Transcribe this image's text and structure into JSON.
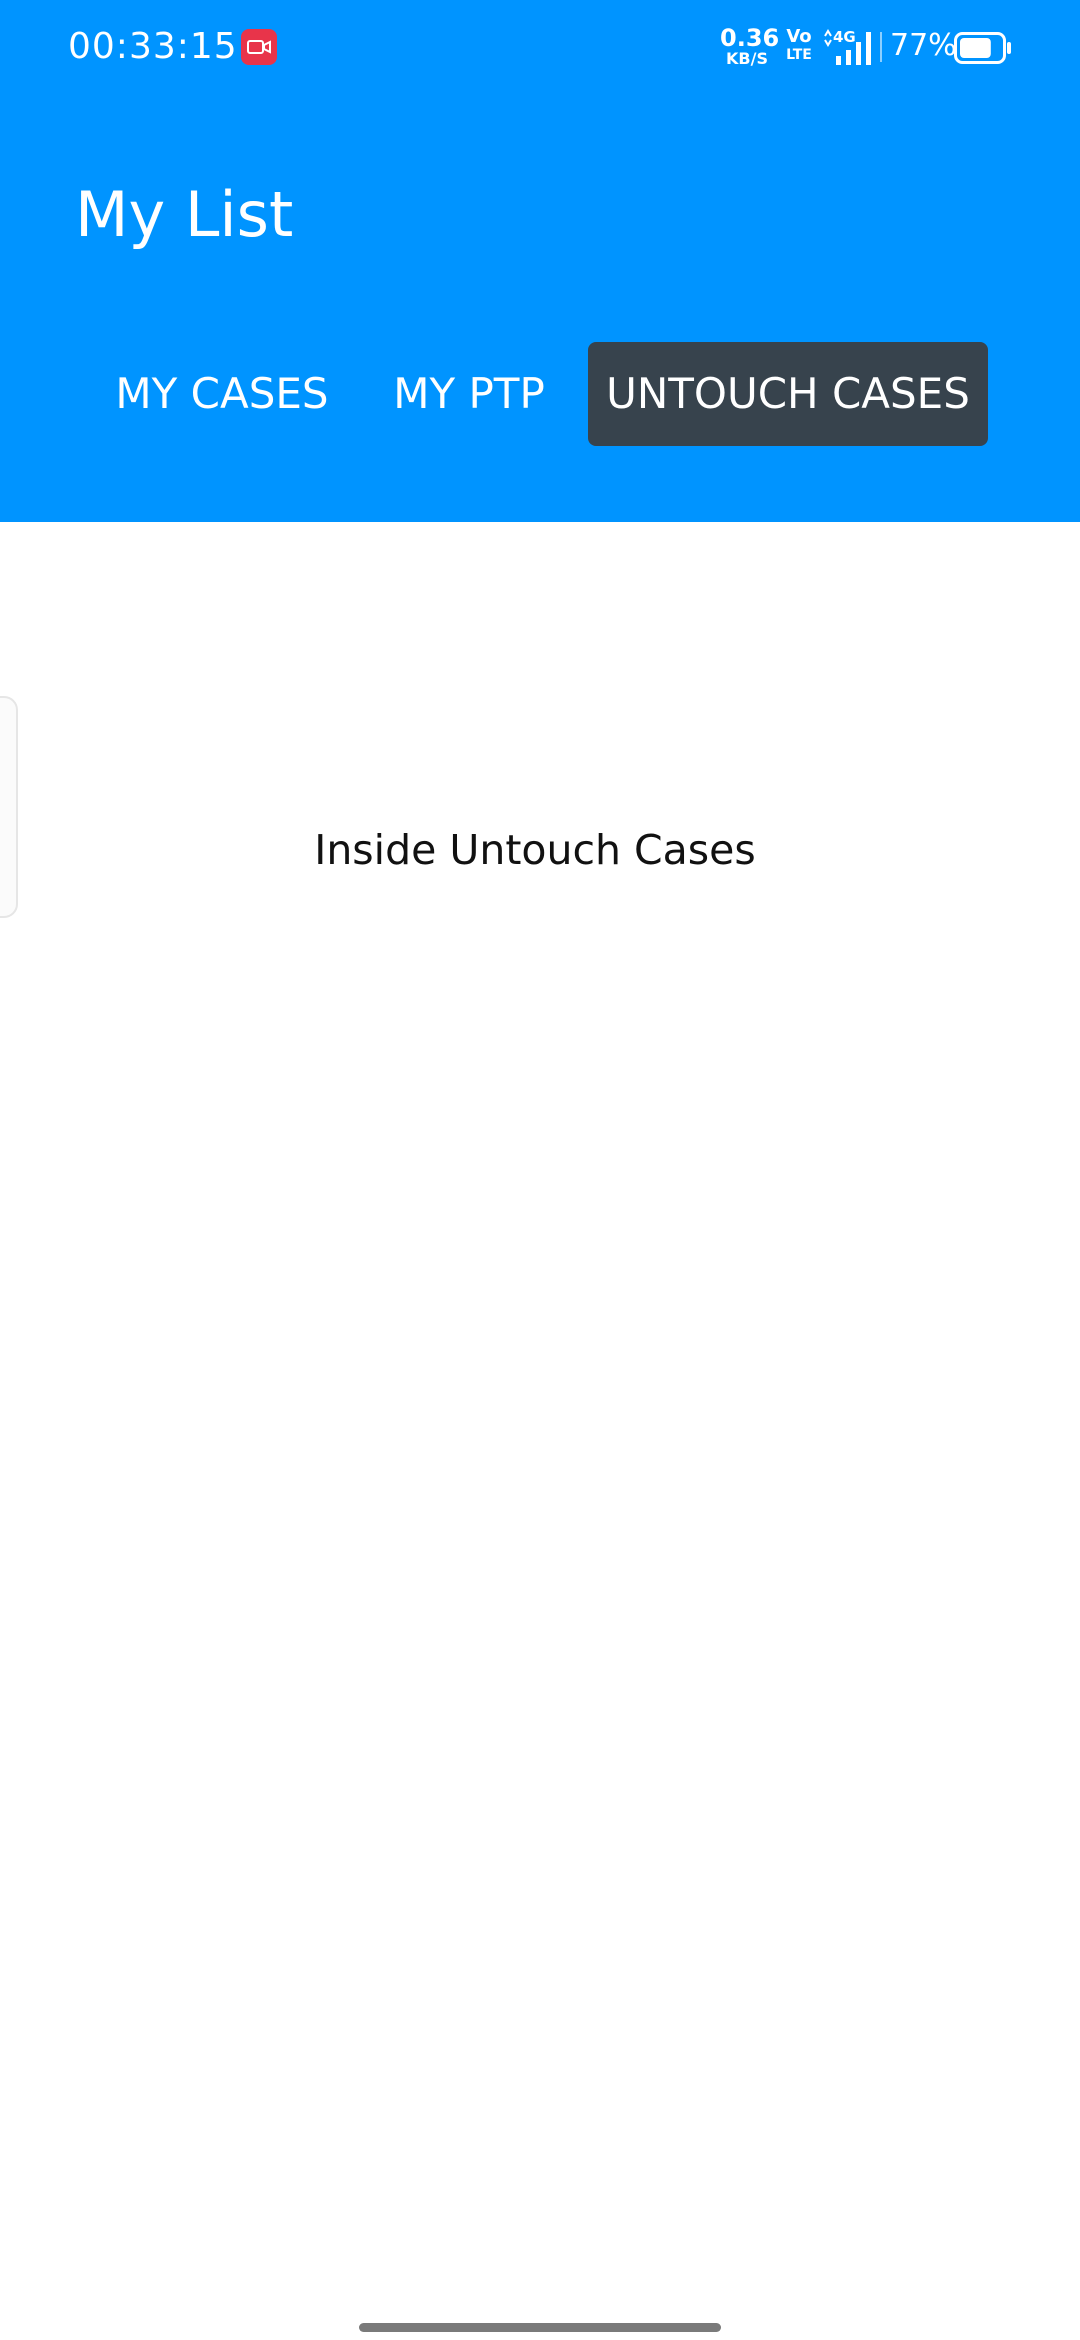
{
  "status_bar": {
    "time": "00:33:15",
    "network_speed_value": "0.36",
    "network_speed_unit": "KB/S",
    "volte_top": "Vo",
    "volte_bottom": "LTE",
    "network_type": "4G",
    "battery_percent": "77%",
    "battery_level": 0.77,
    "icons": [
      "screen-record-icon",
      "signal-icon",
      "battery-icon"
    ]
  },
  "app_bar": {
    "title": "My List"
  },
  "tabs": [
    {
      "label": "MY CASES",
      "selected": false
    },
    {
      "label": "MY PTP",
      "selected": false
    },
    {
      "label": "UNTOUCH CASES",
      "selected": true
    }
  ],
  "content": {
    "message": "Inside Untouch Cases"
  },
  "colors": {
    "header": "#0094FF",
    "selected_tab": "#37434D",
    "record_badge": "#E8344A",
    "text_on_header": "#FFFFFF",
    "content_text": "#111111"
  }
}
